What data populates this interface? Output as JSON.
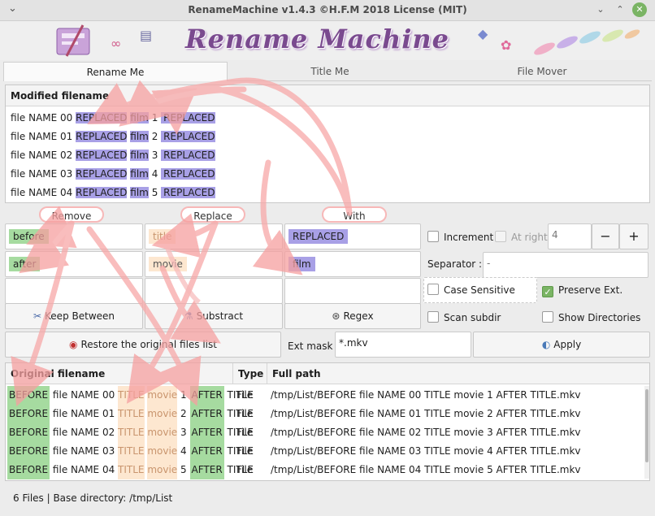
{
  "window": {
    "title": "RenameMachine v1.4.3  ©H.F.M 2018 License (MIT)"
  },
  "banner": {
    "logo_text": "Rename Machine"
  },
  "tabs": [
    {
      "label": "Rename Me"
    },
    {
      "label": "Title Me"
    },
    {
      "label": "File Mover"
    }
  ],
  "modified": {
    "header": "Modified filename",
    "rows": [
      {
        "prefix": "file NAME 00",
        "rep1": "REPLACED",
        "film": "film",
        "num": "1",
        "rep2": "REPLACED"
      },
      {
        "prefix": "file NAME 01",
        "rep1": "REPLACED",
        "film": "film",
        "num": "2",
        "rep2": "REPLACED"
      },
      {
        "prefix": "file NAME 02",
        "rep1": "REPLACED",
        "film": "film",
        "num": "3",
        "rep2": "REPLACED"
      },
      {
        "prefix": "file NAME 03",
        "rep1": "REPLACED",
        "film": "film",
        "num": "4",
        "rep2": "REPLACED"
      },
      {
        "prefix": "file NAME 04",
        "rep1": "REPLACED",
        "film": "film",
        "num": "5",
        "rep2": "REPLACED"
      }
    ]
  },
  "columns": {
    "remove": "Remove",
    "replace": "Replace",
    "with": "With"
  },
  "inputs": {
    "remove1": "before",
    "remove2": "after",
    "remove3": "",
    "replace1": "title",
    "replace2": "movie",
    "replace3": "",
    "with1": "REPLACED",
    "with2": "film",
    "with3": ""
  },
  "options": {
    "increment": "Increment",
    "at_right": "At right",
    "increment_value": "4",
    "minus": "−",
    "plus": "+",
    "separator_label": "Separator :",
    "separator_value": "-",
    "case_sensitive": "Case Sensitive",
    "preserve_ext": "Preserve  Ext.",
    "scan_subdir": "Scan subdir",
    "show_directories": "Show Directories",
    "ext_mask_label": "Ext mask :",
    "ext_mask_value": "*.mkv"
  },
  "buttons": {
    "keep_between": "Keep Between",
    "substract": "Substract",
    "regex": "Regex",
    "restore": "Restore the original files list",
    "apply": "Apply"
  },
  "original": {
    "headers": {
      "name": "Original filename",
      "type": "Type",
      "path": "Full path"
    },
    "rows": [
      {
        "before": "BEFORE",
        "mid": "file NAME 00",
        "title": "TITLE",
        "movie": "movie",
        "num": "1",
        "after": "AFTER",
        "title2": "TITLE",
        "type": "File",
        "path": "/tmp/List/BEFORE file NAME 00 TITLE movie 1 AFTER TITLE.mkv"
      },
      {
        "before": "BEFORE",
        "mid": "file NAME 01",
        "title": "TITLE",
        "movie": "movie",
        "num": "2",
        "after": "AFTER",
        "title2": "TITLE",
        "type": "File",
        "path": "/tmp/List/BEFORE file NAME 01 TITLE movie 2 AFTER TITLE.mkv"
      },
      {
        "before": "BEFORE",
        "mid": "file NAME 02",
        "title": "TITLE",
        "movie": "movie",
        "num": "3",
        "after": "AFTER",
        "title2": "TITLE",
        "type": "File",
        "path": "/tmp/List/BEFORE file NAME 02 TITLE movie 3 AFTER TITLE.mkv"
      },
      {
        "before": "BEFORE",
        "mid": "file NAME 03",
        "title": "TITLE",
        "movie": "movie",
        "num": "4",
        "after": "AFTER",
        "title2": "TITLE",
        "type": "File",
        "path": "/tmp/List/BEFORE file NAME 03 TITLE movie 4 AFTER TITLE.mkv"
      },
      {
        "before": "BEFORE",
        "mid": "file NAME 04",
        "title": "TITLE",
        "movie": "movie",
        "num": "5",
        "after": "AFTER",
        "title2": "TITLE",
        "type": "File",
        "path": "/tmp/List/BEFORE file NAME 04 TITLE movie 5 AFTER TITLE.mkv"
      }
    ]
  },
  "status": {
    "text": "6 Files | Base directory: /tmp/List"
  },
  "colors": {
    "blue_hl": "#a8a0e6",
    "green_hl": "#a6dba0",
    "orange_hl": "#fde7d0",
    "arrow": "#f7a8a8",
    "accent": "#7ab464"
  }
}
